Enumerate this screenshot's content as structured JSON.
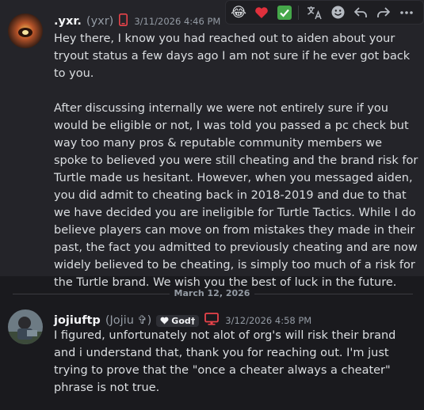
{
  "message1": {
    "username": ".yxr.",
    "nickname": "(yxr)",
    "timestamp": "3/11/2026 4:46 PM",
    "body": "Hey there, I know you had reached out to aiden about your tryout status a few days ago I am not sure if he ever got back to you.\n\nAfter discussing internally we were not entirely sure if you would be eligible or not, I was told you passed a pc check but way too many pros & reputable community members we spoke to believed you were still cheating and the brand risk for Turtle made us hesitant. However, when you messaged aiden, you did admit to cheating back in 2018-2019 and due to that we have decided you are ineligible for Turtle Tactics. While I do believe players can move on from mistakes they made in their past, the fact you admitted to previously cheating and are now widely believed to be cheating, is simply too much of a risk for the Turtle brand. We wish you the best of luck in the future."
  },
  "toolbar": {
    "reactions": [
      "😂",
      "❤️",
      "✅"
    ],
    "icons": [
      "translate-icon",
      "add-reaction-icon",
      "reply-icon",
      "forward-icon",
      "more-icon"
    ]
  },
  "divider": {
    "label": "March 12, 2026"
  },
  "message2": {
    "username": "jojiuftp",
    "nickname": "(Jojiu ✞)",
    "tag": "God†",
    "timestamp": "3/12/2026 4:58 PM",
    "body": "I figured, unfortunately not alot of org's will risk their brand and i understand that, thank you for reaching out. I'm just trying to prove that the \"once a cheater always a cheater\" phrase is not true."
  },
  "colors": {
    "phone_badge": "#e8434a",
    "monitor_badge": "#e8434a",
    "timestamp": "#949ba4"
  }
}
